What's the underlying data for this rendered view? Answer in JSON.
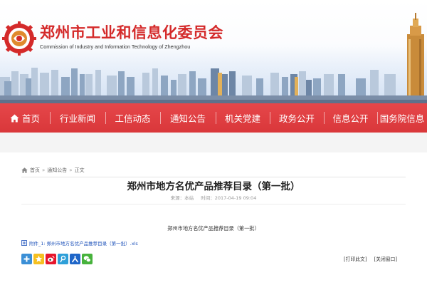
{
  "header": {
    "site_title": "郑州市工业和信息化委员会",
    "site_subtitle": "Commission of Industry and Information Technology of Zhengzhou",
    "accent_color": "#d42a2a"
  },
  "nav": {
    "items": [
      {
        "label": "首页",
        "icon": "home-icon"
      },
      {
        "label": "行业新闻"
      },
      {
        "label": "工信动态"
      },
      {
        "label": "通知公告"
      },
      {
        "label": "机关党建"
      },
      {
        "label": "政务公开"
      },
      {
        "label": "信息公开"
      },
      {
        "label": "国务院信息"
      }
    ],
    "bar_color": "#e0403f"
  },
  "breadcrumb": {
    "items": [
      "首页",
      "通知公告",
      "正文"
    ],
    "separator": "»"
  },
  "article": {
    "title": "郑州市地方名优产品推荐目录（第一批）",
    "source": "来源：本站",
    "time": "时间：2017-04-19 09:04",
    "body": "郑州市地方名优产品推荐目录（第一批）",
    "attachment": "附件_1: 郑州市地方名优产品推荐目录（第一批）.xls"
  },
  "share": {
    "icons": [
      "share-plus-icon",
      "qzone-icon",
      "weibo-icon",
      "tencent-weibo-icon",
      "renren-icon",
      "wechat-icon"
    ]
  },
  "actions": {
    "print": "[打印此文]",
    "close": "[关闭窗口]"
  }
}
